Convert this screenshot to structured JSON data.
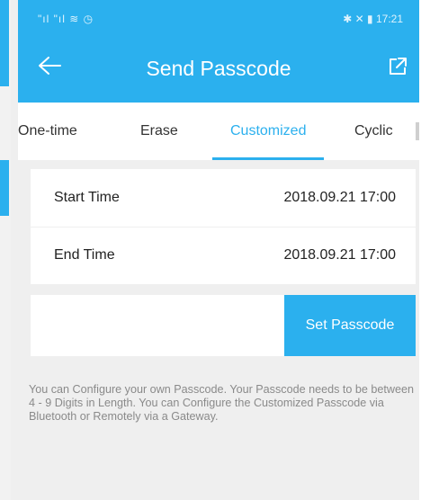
{
  "status_bar": {
    "left": "\"ıl \"ıl ≋ ◷",
    "right": "✱ ✕ ▮ 17:21"
  },
  "header": {
    "title": "Send Passcode"
  },
  "tabs": [
    {
      "label": "One-time"
    },
    {
      "label": "Erase"
    },
    {
      "label": "Customized"
    },
    {
      "label": "Cyclic"
    }
  ],
  "form": {
    "start_label": "Start Time",
    "start_value": "2018.09.21 17:00",
    "end_label": "End Time",
    "end_value": "2018.09.21 17:00"
  },
  "passcode": {
    "value": "",
    "button_label": "Set Passcode"
  },
  "info_text": "You can Configure your own Passcode. Your Passcode needs to be between 4 - 9 Digits in Length. You can Configure the Customized Passcode via Bluetooth or Remotely via a Gateway.",
  "colors": {
    "accent": "#2bb0ee",
    "background": "#efefef"
  },
  "icons": [
    "back-arrow-icon",
    "share-icon"
  ]
}
